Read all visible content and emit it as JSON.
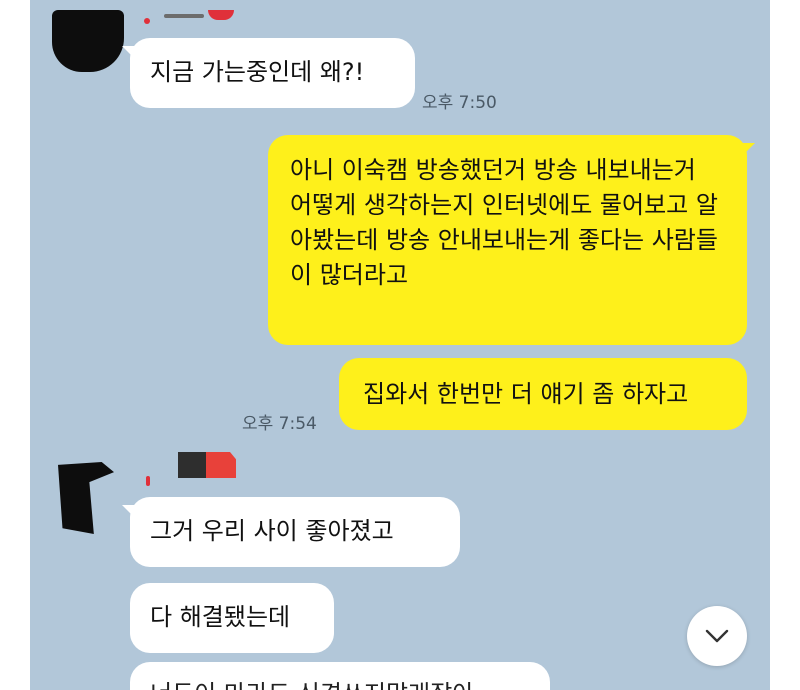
{
  "messages": [
    {
      "side": "incoming",
      "text": "지금 가는중인데 왜?!"
    },
    {
      "side": "outgoing",
      "text": "아니 이숙캠 방송했던거 방송 내보내는거 어떻게 생각하는지 인터넷에도 물어보고 알아봤는데 방송 안내보내는게 좋다는 사람들이 많더라고"
    },
    {
      "side": "outgoing",
      "text": "집와서 한번만 더 얘기 좀 하자고"
    },
    {
      "side": "incoming",
      "text": "그거 우리 사이 좋아졌고"
    },
    {
      "side": "incoming",
      "text": "다 해결됐는데"
    },
    {
      "side": "incoming",
      "text": "너두이 마라도 신경쓰지말래잖아"
    }
  ],
  "timestamps": {
    "first": "오후 7:50",
    "second": "오후 7:54"
  },
  "icons": {
    "scroll_bottom": "chevron-down-icon"
  },
  "colors": {
    "background": "#b2c7d9",
    "outgoing_bubble": "#fef01b",
    "incoming_bubble": "#ffffff"
  }
}
